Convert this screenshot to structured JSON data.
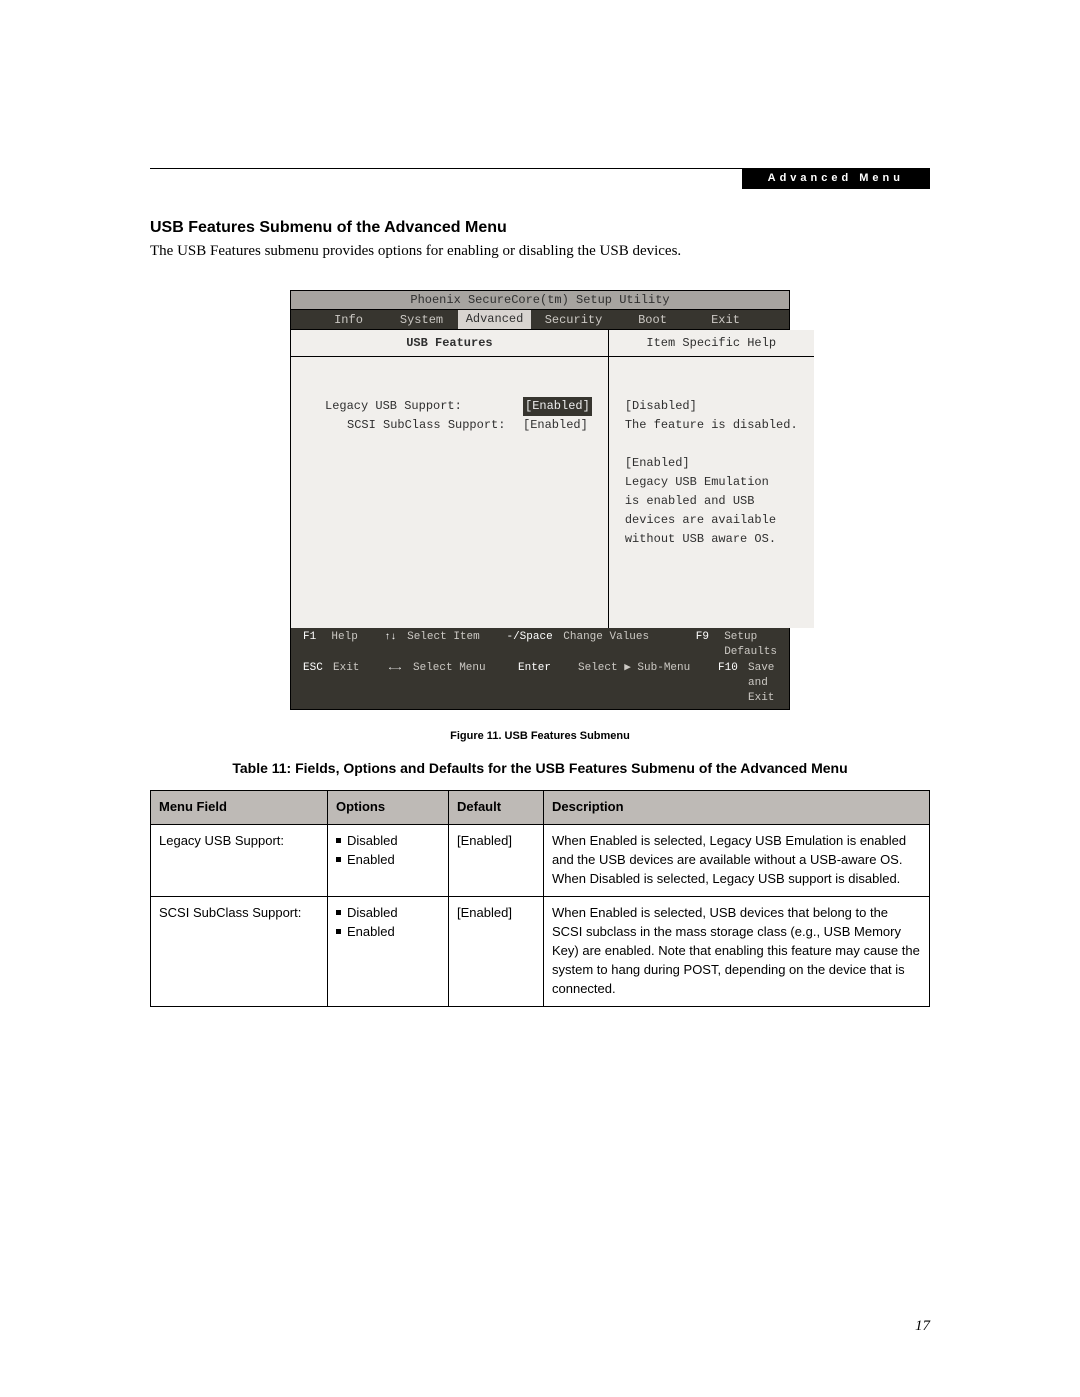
{
  "header_tag": "Advanced Menu",
  "heading": "USB Features Submenu of the Advanced Menu",
  "intro": "The USB Features submenu provides options for enabling or disabling the USB devices.",
  "bios": {
    "title": "Phoenix SecureCore(tm) Setup Utility",
    "tabs": [
      "Info",
      "System",
      "Advanced",
      "Security",
      "Boot",
      "Exit"
    ],
    "active_tab": "Advanced",
    "left_panel_title": "USB Features",
    "items": [
      {
        "label": "Legacy USB Support:",
        "value": "[Enabled]",
        "highlight": true,
        "indent": false
      },
      {
        "label": "SCSI SubClass Support:",
        "value": "[Enabled]",
        "highlight": false,
        "indent": true
      }
    ],
    "help_title": "Item Specific Help",
    "help_lines": [
      "[Disabled]",
      "The feature is disabled.",
      "",
      "[Enabled]",
      "Legacy USB Emulation",
      "is enabled and USB",
      "devices are available",
      "without USB aware OS."
    ],
    "footer": {
      "row1": {
        "k1": "F1",
        "l1": "Help",
        "k2": "↑↓",
        "l2": "Select Item",
        "k3": "-/Space",
        "l3": "Change Values",
        "k4": "F9",
        "l4": "Setup Defaults"
      },
      "row2": {
        "k1": "ESC",
        "l1": "Exit",
        "k2": "←→",
        "l2": "Select Menu",
        "k3": "Enter",
        "l3": "Select ▶ Sub-Menu",
        "k4": "F10",
        "l4": "Save and Exit"
      }
    }
  },
  "figure_caption": "Figure 11.  USB Features Submenu",
  "table_caption": "Table 11: Fields, Options and Defaults for the USB Features Submenu of the Advanced Menu",
  "table": {
    "headers": [
      "Menu Field",
      "Options",
      "Default",
      "Description"
    ],
    "rows": [
      {
        "menu": "Legacy USB Support:",
        "options": [
          "Disabled",
          "Enabled"
        ],
        "default": "[Enabled]",
        "desc": "When Enabled is selected, Legacy USB Emulation is enabled and the USB devices are available without a USB-aware OS. When Disabled is selected, Legacy USB support is disabled."
      },
      {
        "menu": "SCSI SubClass Support:",
        "options": [
          "Disabled",
          "Enabled"
        ],
        "default": "[Enabled]",
        "desc": "When Enabled is selected, USB devices that belong to the SCSI subclass in the mass storage class (e.g., USB Memory Key) are enabled. Note that enabling this feature may cause the system to hang during POST, depending on the device that is connected."
      }
    ]
  },
  "page_number": "17"
}
